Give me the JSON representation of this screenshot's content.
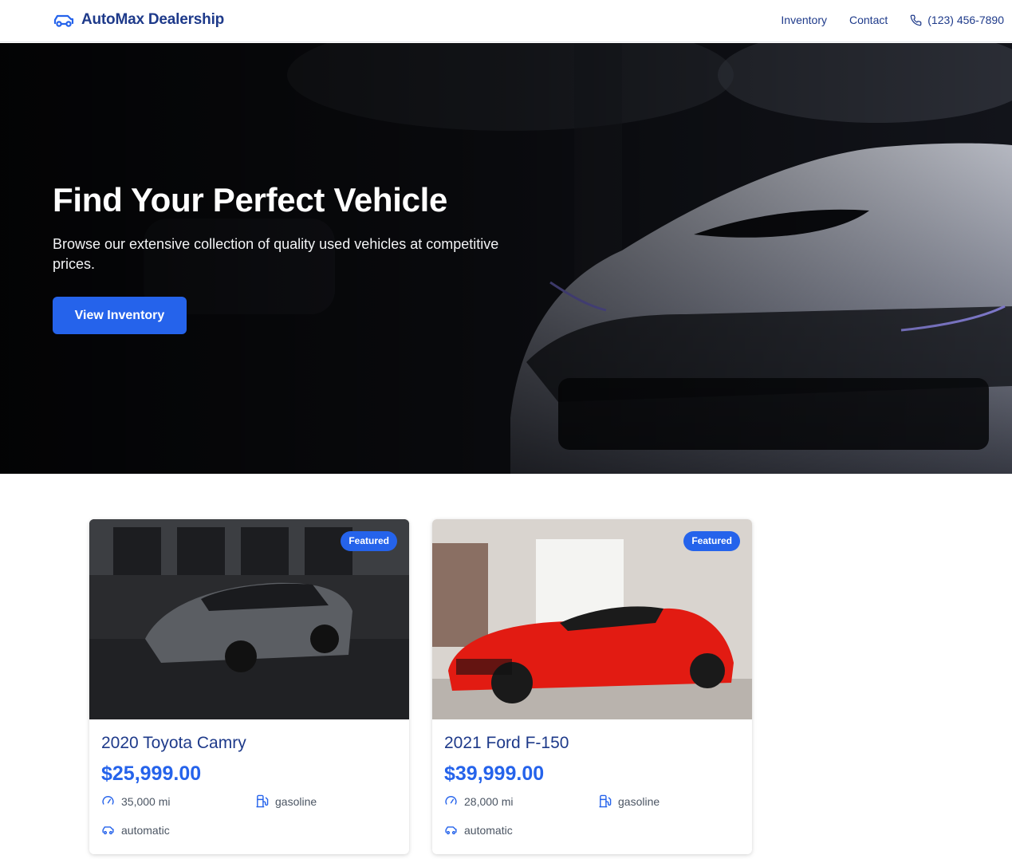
{
  "header": {
    "brand": "AutoMax Dealership",
    "nav": {
      "inventory": "Inventory",
      "contact": "Contact",
      "phone": "(123) 456-7890"
    }
  },
  "hero": {
    "title": "Find Your Perfect Vehicle",
    "subtitle": "Browse our extensive collection of quality used vehicles at competitive prices.",
    "cta": "View Inventory"
  },
  "listings": [
    {
      "badge": "Featured",
      "title": "2020 Toyota Camry",
      "price": "$25,999.00",
      "mileage": "35,000 mi",
      "fuel": "gasoline",
      "transmission": "automatic",
      "car_color": "#5b5e63"
    },
    {
      "badge": "Featured",
      "title": "2021 Ford F-150",
      "price": "$39,999.00",
      "mileage": "28,000 mi",
      "fuel": "gasoline",
      "transmission": "automatic",
      "car_color": "#e21b12"
    }
  ],
  "colors": {
    "primary": "#2563eb",
    "brand_text": "#1e3a8a",
    "hero_bg": "#0e1016"
  },
  "icons": [
    "car-icon",
    "phone-icon",
    "speedometer-icon",
    "fuel-icon",
    "car-icon"
  ]
}
